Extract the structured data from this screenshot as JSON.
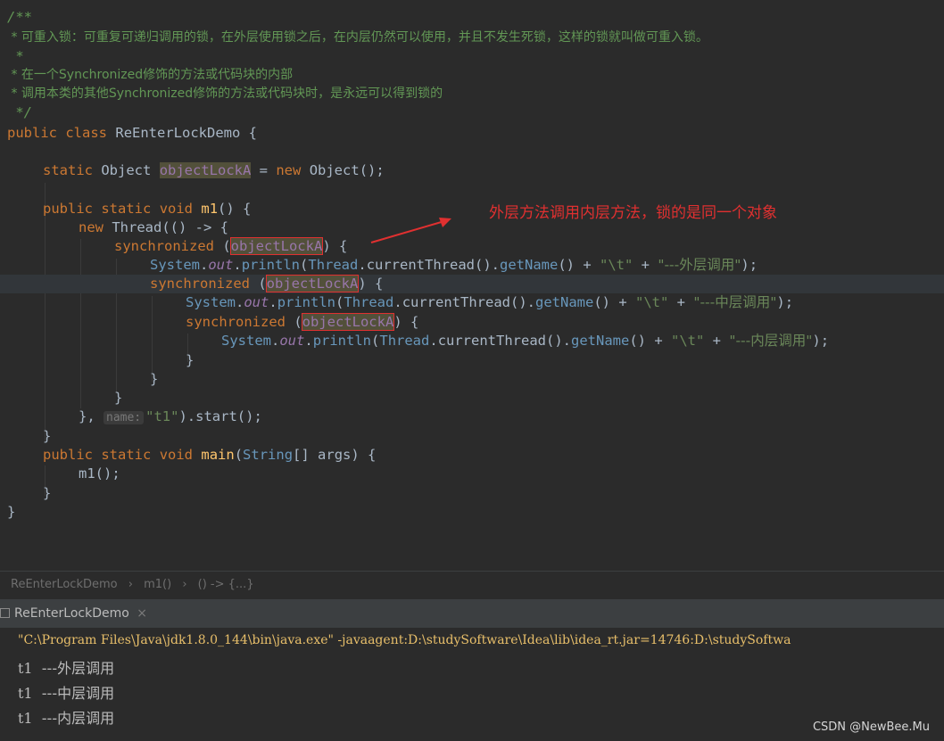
{
  "code": {
    "c1": "/**",
    "c2": " * 可重入锁：可重复可递归调用的锁，在外层使用锁之后，在内层仍然可以使用，并且不发生死锁，这样的锁就叫做可重入锁。",
    "c3": " *",
    "c4": " * 在一个Synchronized修饰的方法或代码块的内部",
    "c5": " * 调用本类的其他Synchronized修饰的方法或代码块时，是永远可以得到锁的",
    "c6": " */",
    "public": "public",
    "class": "class",
    "classname": "ReEnterLockDemo",
    "brace_open": " {",
    "static": "static",
    "object": "Object",
    "lockvar": "objectLockA",
    "assign": " = ",
    "new": "new",
    "object_ctor": "Object",
    "ctor_end": "();",
    "void": "void",
    "m1": "m1",
    "m1_sig": "() {",
    "thread": "Thread",
    "lambda": "(() -> {",
    "synchronized": "synchronized",
    "paren_open": " (",
    "paren_close": ") {",
    "system": "System",
    "dot": ".",
    "out": "out",
    "println": "println",
    "lp": "(",
    "current": ".currentThread().",
    "getname": "getName",
    "concat1": "() + ",
    "tab": "\"\\t\"",
    "plus": " + ",
    "s_outer": "\"---外层调用\"",
    "s_middle": "\"---中层调用\"",
    "s_inner": "\"---内层调用\"",
    "end_call": ");",
    "close": "}",
    "close_lambda": "}, ",
    "hint_name": "name:",
    "t1_arg": "\"t1\"",
    "start": ").start();",
    "main": "main",
    "string": "String",
    "args": "[] args) {",
    "m1_call": "m1();"
  },
  "annotation": "外层方法调用内层方法，锁的是同一个对象",
  "breadcrumb": [
    "ReEnterLockDemo",
    "m1()",
    "() -> {...}"
  ],
  "run_tab": {
    "label": "ReEnterLockDemo",
    "close": "×"
  },
  "console": {
    "command": "\"C:\\Program Files\\Java\\jdk1.8.0_144\\bin\\java.exe\" -javaagent:D:\\studySoftware\\Idea\\lib\\idea_rt.jar=14746:D:\\studySoftwa",
    "lines": [
      {
        "thread": "t1",
        "msg": "---外层调用"
      },
      {
        "thread": "t1",
        "msg": "---中层调用"
      },
      {
        "thread": "t1",
        "msg": "---内层调用"
      }
    ]
  },
  "watermark": "CSDN @NewBee.Mu",
  "colors": {
    "keyword": "#cc7832",
    "comment": "#629755",
    "string": "#6a8759",
    "annotation": "#e03030",
    "field": "#9876aa"
  }
}
